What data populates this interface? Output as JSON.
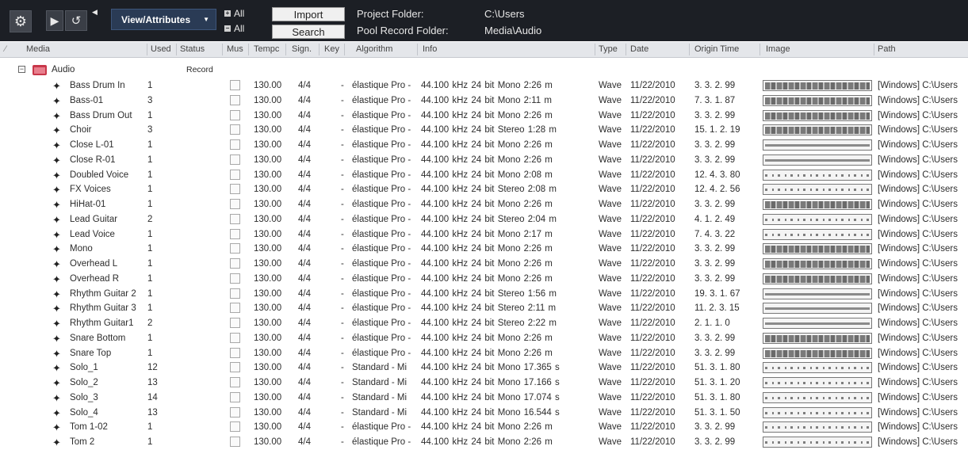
{
  "toolbar": {
    "view_attributes_label": "View/Attributes",
    "all_plus_label": "All",
    "all_minus_label": "All",
    "import_label": "Import",
    "search_label": "Search",
    "project_folder_label": "Project Folder:",
    "project_folder_value": "C:\\Users",
    "pool_record_folder_label": "Pool Record Folder:",
    "pool_record_folder_value": "Media\\Audio"
  },
  "columns": {
    "media": "Media",
    "used": "Used",
    "status": "Status",
    "mus": "Mus",
    "tempo": "Tempc",
    "sign": "Sign.",
    "key": "Key",
    "algorithm": "Algorithm",
    "info": "Info",
    "type": "Type",
    "date": "Date",
    "origin_time": "Origin Time",
    "image": "Image",
    "path": "Path"
  },
  "folder": {
    "name": "Audio",
    "status": "Record",
    "color": "#c8374a"
  },
  "rows": [
    {
      "name": "Bass Drum In",
      "used": "1",
      "tempo": "130.00",
      "sign": "4/4",
      "key": "-",
      "algorithm": "élastique Pro -",
      "info": "44.100 kHz  24 bit  Mono  2:26 m",
      "type": "Wave",
      "date": "11/22/2010",
      "origin": "3. 3. 2. 99",
      "path": "[Windows] C:\\Users",
      "wave": "dense"
    },
    {
      "name": "Bass-01",
      "used": "3",
      "tempo": "130.00",
      "sign": "4/4",
      "key": "-",
      "algorithm": "élastique Pro -",
      "info": "44.100 kHz  24 bit  Mono  2:11 m",
      "type": "Wave",
      "date": "11/22/2010",
      "origin": "7. 3. 1. 87",
      "path": "[Windows] C:\\Users",
      "wave": "dense"
    },
    {
      "name": "Bass Drum Out",
      "used": "1",
      "tempo": "130.00",
      "sign": "4/4",
      "key": "-",
      "algorithm": "élastique Pro -",
      "info": "44.100 kHz  24 bit  Mono  2:26 m",
      "type": "Wave",
      "date": "11/22/2010",
      "origin": "3. 3. 2. 99",
      "path": "[Windows] C:\\Users",
      "wave": "dense"
    },
    {
      "name": "Choir",
      "used": "3",
      "tempo": "130.00",
      "sign": "4/4",
      "key": "-",
      "algorithm": "élastique Pro -",
      "info": "44.100 kHz  24 bit  Stereo  1:28 m",
      "type": "Wave",
      "date": "11/22/2010",
      "origin": "15. 1. 2. 19",
      "path": "[Windows] C:\\Users",
      "wave": "dense"
    },
    {
      "name": "Close L-01",
      "used": "1",
      "tempo": "130.00",
      "sign": "4/4",
      "key": "-",
      "algorithm": "élastique Pro -",
      "info": "44.100 kHz  24 bit  Mono  2:26 m",
      "type": "Wave",
      "date": "11/22/2010",
      "origin": "3. 3. 2. 99",
      "path": "[Windows] C:\\Users",
      "wave": "bar"
    },
    {
      "name": "Close R-01",
      "used": "1",
      "tempo": "130.00",
      "sign": "4/4",
      "key": "-",
      "algorithm": "élastique Pro -",
      "info": "44.100 kHz  24 bit  Mono  2:26 m",
      "type": "Wave",
      "date": "11/22/2010",
      "origin": "3. 3. 2. 99",
      "path": "[Windows] C:\\Users",
      "wave": "bar"
    },
    {
      "name": "Doubled Voice",
      "used": "1",
      "tempo": "130.00",
      "sign": "4/4",
      "key": "-",
      "algorithm": "élastique Pro -",
      "info": "44.100 kHz  24 bit  Mono  2:08 m",
      "type": "Wave",
      "date": "11/22/2010",
      "origin": "12. 4. 3. 80",
      "path": "[Windows] C:\\Users",
      "wave": "sparse"
    },
    {
      "name": "FX Voices",
      "used": "1",
      "tempo": "130.00",
      "sign": "4/4",
      "key": "-",
      "algorithm": "élastique Pro -",
      "info": "44.100 kHz  24 bit  Stereo  2:08 m",
      "type": "Wave",
      "date": "11/22/2010",
      "origin": "12. 4. 2. 56",
      "path": "[Windows] C:\\Users",
      "wave": "sparse"
    },
    {
      "name": "HiHat-01",
      "used": "1",
      "tempo": "130.00",
      "sign": "4/4",
      "key": "-",
      "algorithm": "élastique Pro -",
      "info": "44.100 kHz  24 bit  Mono  2:26 m",
      "type": "Wave",
      "date": "11/22/2010",
      "origin": "3. 3. 2. 99",
      "path": "[Windows] C:\\Users",
      "wave": "dense"
    },
    {
      "name": "Lead Guitar",
      "used": "2",
      "tempo": "130.00",
      "sign": "4/4",
      "key": "-",
      "algorithm": "élastique Pro -",
      "info": "44.100 kHz  24 bit  Stereo  2:04 m",
      "type": "Wave",
      "date": "11/22/2010",
      "origin": "4. 1. 2. 49",
      "path": "[Windows] C:\\Users",
      "wave": "sparse"
    },
    {
      "name": "Lead Voice",
      "used": "1",
      "tempo": "130.00",
      "sign": "4/4",
      "key": "-",
      "algorithm": "élastique Pro -",
      "info": "44.100 kHz  24 bit  Mono  2:17 m",
      "type": "Wave",
      "date": "11/22/2010",
      "origin": "7. 4. 3. 22",
      "path": "[Windows] C:\\Users",
      "wave": "sparse"
    },
    {
      "name": "Mono",
      "used": "1",
      "tempo": "130.00",
      "sign": "4/4",
      "key": "-",
      "algorithm": "élastique Pro -",
      "info": "44.100 kHz  24 bit  Mono  2:26 m",
      "type": "Wave",
      "date": "11/22/2010",
      "origin": "3. 3. 2. 99",
      "path": "[Windows] C:\\Users",
      "wave": "dense"
    },
    {
      "name": "Overhead L",
      "used": "1",
      "tempo": "130.00",
      "sign": "4/4",
      "key": "-",
      "algorithm": "élastique Pro -",
      "info": "44.100 kHz  24 bit  Mono  2:26 m",
      "type": "Wave",
      "date": "11/22/2010",
      "origin": "3. 3. 2. 99",
      "path": "[Windows] C:\\Users",
      "wave": "dense"
    },
    {
      "name": "Overhead R",
      "used": "1",
      "tempo": "130.00",
      "sign": "4/4",
      "key": "-",
      "algorithm": "élastique Pro -",
      "info": "44.100 kHz  24 bit  Mono  2:26 m",
      "type": "Wave",
      "date": "11/22/2010",
      "origin": "3. 3. 2. 99",
      "path": "[Windows] C:\\Users",
      "wave": "dense"
    },
    {
      "name": "Rhythm Guitar 2",
      "used": "1",
      "tempo": "130.00",
      "sign": "4/4",
      "key": "-",
      "algorithm": "élastique Pro -",
      "info": "44.100 kHz  24 bit  Stereo  1:56 m",
      "type": "Wave",
      "date": "11/22/2010",
      "origin": "19. 3. 1. 67",
      "path": "[Windows] C:\\Users",
      "wave": "bar"
    },
    {
      "name": "Rhythm Guitar 3",
      "used": "1",
      "tempo": "130.00",
      "sign": "4/4",
      "key": "-",
      "algorithm": "élastique Pro -",
      "info": "44.100 kHz  24 bit  Stereo  2:11 m",
      "type": "Wave",
      "date": "11/22/2010",
      "origin": "11. 2. 3. 15",
      "path": "[Windows] C:\\Users",
      "wave": "bar"
    },
    {
      "name": "Rhythm Guitar1",
      "used": "2",
      "tempo": "130.00",
      "sign": "4/4",
      "key": "-",
      "algorithm": "élastique Pro -",
      "info": "44.100 kHz  24 bit  Stereo  2:22 m",
      "type": "Wave",
      "date": "11/22/2010",
      "origin": "2. 1. 1.  0",
      "path": "[Windows] C:\\Users",
      "wave": "bar"
    },
    {
      "name": "Snare Bottom",
      "used": "1",
      "tempo": "130.00",
      "sign": "4/4",
      "key": "-",
      "algorithm": "élastique Pro -",
      "info": "44.100 kHz  24 bit  Mono  2:26 m",
      "type": "Wave",
      "date": "11/22/2010",
      "origin": "3. 3. 2. 99",
      "path": "[Windows] C:\\Users",
      "wave": "dense"
    },
    {
      "name": "Snare Top",
      "used": "1",
      "tempo": "130.00",
      "sign": "4/4",
      "key": "-",
      "algorithm": "élastique Pro -",
      "info": "44.100 kHz  24 bit  Mono  2:26 m",
      "type": "Wave",
      "date": "11/22/2010",
      "origin": "3. 3. 2. 99",
      "path": "[Windows] C:\\Users",
      "wave": "dense"
    },
    {
      "name": "Solo_1",
      "used": "12",
      "tempo": "130.00",
      "sign": "4/4",
      "key": "-",
      "algorithm": "Standard - Mi",
      "info": "44.100 kHz  24 bit  Mono  17.365 s",
      "type": "Wave",
      "date": "11/22/2010",
      "origin": "51. 3. 1. 80",
      "path": "[Windows] C:\\Users",
      "wave": "sparse"
    },
    {
      "name": "Solo_2",
      "used": "13",
      "tempo": "130.00",
      "sign": "4/4",
      "key": "-",
      "algorithm": "Standard - Mi",
      "info": "44.100 kHz  24 bit  Mono  17.166 s",
      "type": "Wave",
      "date": "11/22/2010",
      "origin": "51. 3. 1. 20",
      "path": "[Windows] C:\\Users",
      "wave": "sparse"
    },
    {
      "name": "Solo_3",
      "used": "14",
      "tempo": "130.00",
      "sign": "4/4",
      "key": "-",
      "algorithm": "Standard - Mi",
      "info": "44.100 kHz  24 bit  Mono  17.074 s",
      "type": "Wave",
      "date": "11/22/2010",
      "origin": "51. 3. 1. 80",
      "path": "[Windows] C:\\Users",
      "wave": "sparse"
    },
    {
      "name": "Solo_4",
      "used": "13",
      "tempo": "130.00",
      "sign": "4/4",
      "key": "-",
      "algorithm": "Standard - Mi",
      "info": "44.100 kHz  24 bit  Mono  16.544 s",
      "type": "Wave",
      "date": "11/22/2010",
      "origin": "51. 3. 1. 50",
      "path": "[Windows] C:\\Users",
      "wave": "sparse"
    },
    {
      "name": "Tom 1-02",
      "used": "1",
      "tempo": "130.00",
      "sign": "4/4",
      "key": "-",
      "algorithm": "élastique Pro -",
      "info": "44.100 kHz  24 bit  Mono  2:26 m",
      "type": "Wave",
      "date": "11/22/2010",
      "origin": "3. 3. 2. 99",
      "path": "[Windows] C:\\Users",
      "wave": "sparse"
    },
    {
      "name": "Tom 2",
      "used": "1",
      "tempo": "130.00",
      "sign": "4/4",
      "key": "-",
      "algorithm": "élastique Pro -",
      "info": "44.100 kHz  24 bit  Mono  2:26 m",
      "type": "Wave",
      "date": "11/22/2010",
      "origin": "3. 3. 2. 99",
      "path": "[Windows] C:\\Users",
      "wave": "sparse"
    }
  ],
  "colors": {
    "toolbar_bg": "#1c1f25",
    "view_attributes_bg": "#2a3b55",
    "header_bg": "#e4e6ea",
    "folder_icon": "#c8374a"
  },
  "icons": {
    "settings": "gear-icon",
    "play": "play-icon",
    "loop": "loop-icon",
    "audio_event": "audio-waveform-icon"
  }
}
